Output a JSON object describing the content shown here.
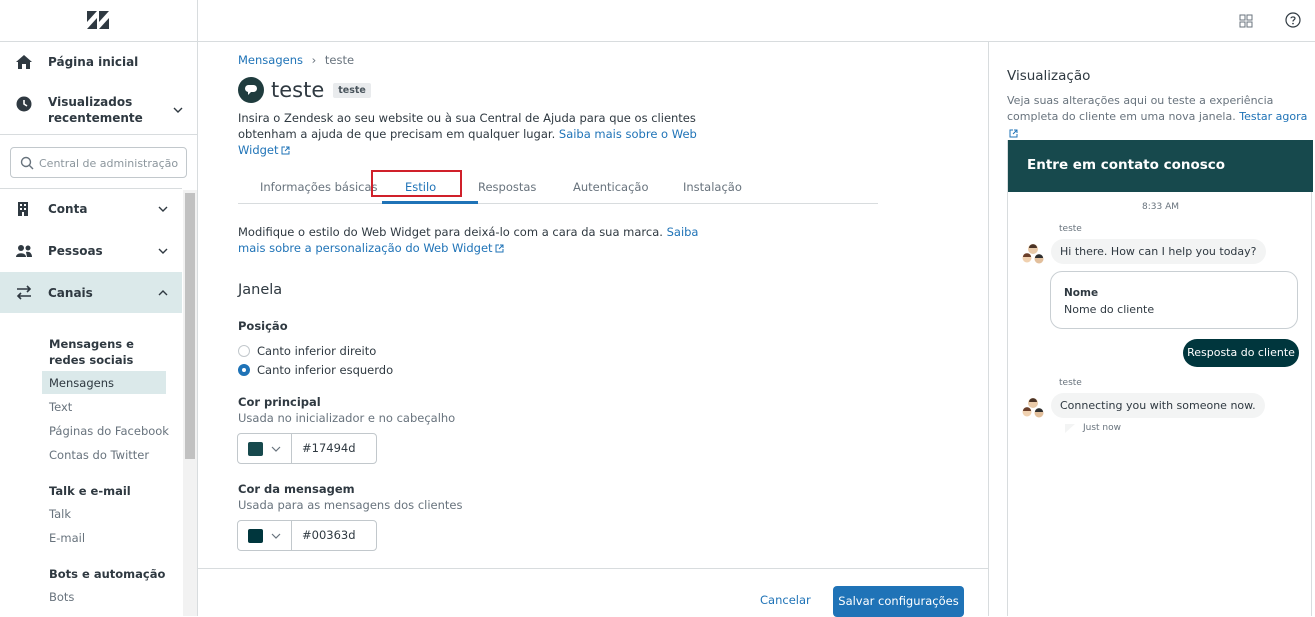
{
  "sidebar": {
    "search_placeholder": "Central de administração",
    "home_label": "Página inicial",
    "recent_label": "Visualizados recentemente",
    "conta_label": "Conta",
    "pessoas_label": "Pessoas",
    "canais_label": "Canais",
    "groups": [
      {
        "heading": "Mensagens e redes sociais",
        "items": [
          "Mensagens",
          "Text",
          "Páginas do Facebook",
          "Contas do Twitter"
        ]
      },
      {
        "heading": "Talk e e-mail",
        "items": [
          "Talk",
          "E-mail"
        ]
      },
      {
        "heading": "Bots e automação",
        "items": [
          "Bots"
        ]
      }
    ],
    "selected_item": "Mensagens",
    "icons": [
      "zendesk-logo",
      "home-icon",
      "recent-icon",
      "building-icon",
      "people-icon",
      "channels-icon"
    ]
  },
  "topbar": {
    "icons": [
      "products-grid-icon",
      "help-icon"
    ]
  },
  "main": {
    "breadcrumb": {
      "parent": "Mensagens",
      "separator": "›",
      "current": "teste"
    },
    "title": "teste",
    "title_badge": "teste",
    "description": "Insira o Zendesk ao seu website ou à sua Central de Ajuda para que os clientes obtenham a ajuda de que precisam em qualquer lugar.",
    "description_link": "Saiba mais sobre o Web Widget",
    "tabs": [
      "Informações básicas",
      "Estilo",
      "Respostas",
      "Autenticação",
      "Instalação"
    ],
    "active_tab": "Estilo",
    "style_desc": "Modifique o estilo do Web Widget para deixá-lo com a cara da sua marca.",
    "style_desc_link": "Saiba mais sobre a personalização do Web Widget",
    "section_title": "Janela",
    "position": {
      "label": "Posição",
      "options": [
        "Canto inferior direito",
        "Canto inferior esquerdo"
      ],
      "selected": "Canto inferior esquerdo"
    },
    "primary_color": {
      "label": "Cor principal",
      "hint": "Usada no inicializador e no cabeçalho",
      "value": "#17494d"
    },
    "message_color": {
      "label": "Cor da mensagem",
      "hint": "Usada para as mensagens dos clientes",
      "value": "#00363d"
    },
    "footer": {
      "cancel": "Cancelar",
      "save": "Salvar configurações"
    }
  },
  "preview": {
    "title": "Visualização",
    "desc": "Veja suas alterações aqui ou teste a experiência completa do cliente em uma nova janela.",
    "desc_link": "Testar agora",
    "widget": {
      "header": "Entre em contato conosco",
      "time": "8:33 AM",
      "author": "teste",
      "greeting": "Hi there. How can I help you today?",
      "form_label": "Nome",
      "form_value": "Nome do cliente",
      "reply": "Resposta do cliente",
      "author2": "teste",
      "connecting": "Connecting you with someone now.",
      "status": "Just now"
    }
  },
  "colors": {
    "accent": "#1f73b7",
    "brand": "#17494d",
    "message": "#00363d",
    "highlight": "#d0202a"
  }
}
